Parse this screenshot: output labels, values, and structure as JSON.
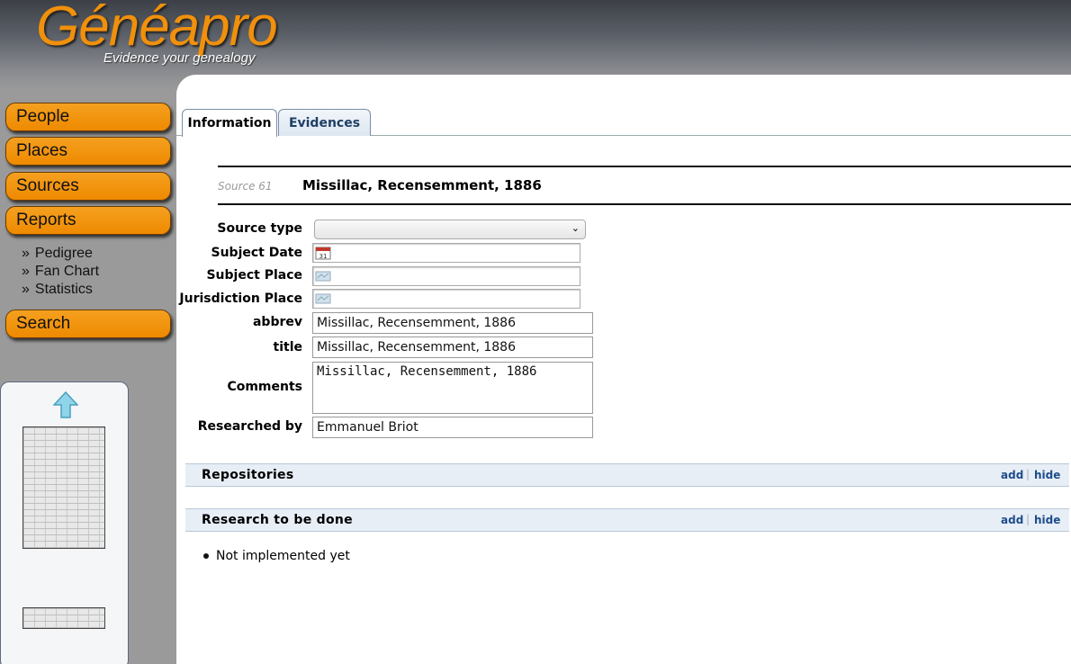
{
  "header": {
    "logo": "Généapro",
    "tagline": "Evidence your genealogy"
  },
  "nav": {
    "people": "People",
    "places": "Places",
    "sources": "Sources",
    "reports": "Reports",
    "report_links": [
      "Pedigree",
      "Fan Chart",
      "Statistics"
    ],
    "bullet": "»",
    "search": "Search"
  },
  "tabs": {
    "information": "Information",
    "evidences": "Evidences"
  },
  "source": {
    "id_label": "Source 61",
    "title": "Missillac, Recensemment, 1886"
  },
  "form": {
    "labels": {
      "source_type": "Source type",
      "subject_date": "Subject Date",
      "subject_place": "Subject Place",
      "jurisdiction_place": "Jurisdiction Place",
      "abbrev": "abbrev",
      "title": "title",
      "comments": "Comments",
      "researched_by": "Researched by"
    },
    "values": {
      "source_type": "",
      "subject_date": "",
      "subject_place": "",
      "jurisdiction_place": "",
      "abbrev": "Missillac, Recensemment, 1886",
      "title": "Missillac, Recensemment, 1886",
      "comments": "Missillac, Recensemment, 1886",
      "researched_by": "Emmanuel Briot"
    },
    "calendar_day": "31"
  },
  "sections": {
    "repositories": "Repositories",
    "research": "Research to be done",
    "add": "add",
    "hide": "hide",
    "separator": "|",
    "todo_items": [
      "Not implemented yet"
    ]
  },
  "colors": {
    "nav_orange": "#ee8a00",
    "logo_orange": "#f0900c",
    "section_bg": "#e8eef6",
    "link_blue": "#1e4c8a"
  }
}
